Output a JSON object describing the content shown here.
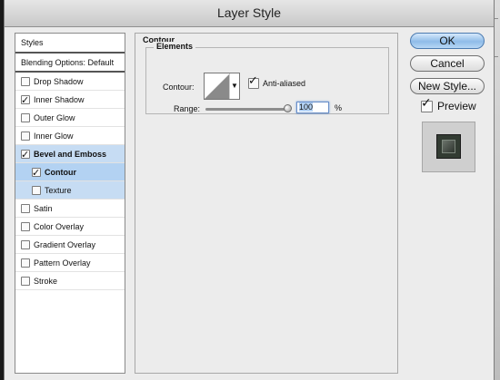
{
  "window": {
    "title": "Layer Style"
  },
  "styles_list": {
    "header": "Styles",
    "blending": "Blending Options: Default",
    "items": [
      {
        "label": "Drop Shadow",
        "checked": false
      },
      {
        "label": "Inner Shadow",
        "checked": true
      },
      {
        "label": "Outer Glow",
        "checked": false
      },
      {
        "label": "Inner Glow",
        "checked": false
      },
      {
        "label": "Bevel and Emboss",
        "checked": true
      },
      {
        "label": "Contour",
        "checked": true
      },
      {
        "label": "Texture",
        "checked": false
      },
      {
        "label": "Satin",
        "checked": false
      },
      {
        "label": "Color Overlay",
        "checked": false
      },
      {
        "label": "Gradient Overlay",
        "checked": false
      },
      {
        "label": "Pattern Overlay",
        "checked": false
      },
      {
        "label": "Stroke",
        "checked": false
      }
    ]
  },
  "panel": {
    "title": "Contour",
    "group_title": "Elements",
    "contour_label": "Contour:",
    "anti_aliased_label": "Anti-aliased",
    "anti_aliased": true,
    "range_label": "Range:",
    "range_value": "100",
    "range_unit": "%",
    "range_level": 1.0
  },
  "buttons": {
    "ok": "OK",
    "cancel": "Cancel",
    "new_style": "New Style...",
    "preview_label": "Preview",
    "preview_checked": true
  },
  "colors": {
    "selection": "#c6dcf3",
    "default_button": "#8fbce8",
    "preview_tile": "#323b32"
  }
}
